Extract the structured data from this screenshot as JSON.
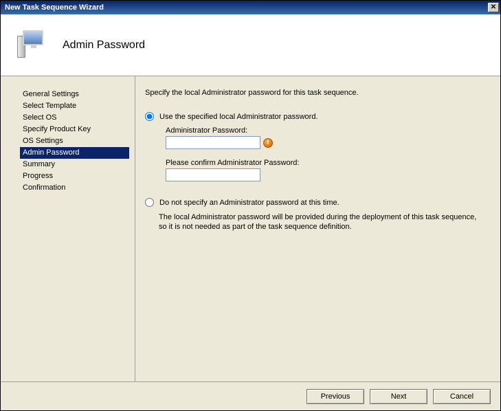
{
  "window": {
    "title": "New Task Sequence Wizard"
  },
  "header": {
    "title": "Admin Password"
  },
  "sidebar": {
    "items": [
      {
        "label": "General Settings",
        "selected": false
      },
      {
        "label": "Select Template",
        "selected": false
      },
      {
        "label": "Select OS",
        "selected": false
      },
      {
        "label": "Specify Product Key",
        "selected": false
      },
      {
        "label": "OS Settings",
        "selected": false
      },
      {
        "label": "Admin Password",
        "selected": true
      },
      {
        "label": "Summary",
        "selected": false
      },
      {
        "label": "Progress",
        "selected": false
      },
      {
        "label": "Confirmation",
        "selected": false
      }
    ]
  },
  "main": {
    "instruction": "Specify the local Administrator password for this task sequence.",
    "option1": {
      "label": "Use the specified local Administrator password.",
      "checked": true,
      "pw_label": "Administrator Password:",
      "pw_value": "",
      "confirm_label": "Please confirm Administrator Password:",
      "confirm_value": ""
    },
    "option2": {
      "label": "Do not specify an Administrator password at this time.",
      "checked": false,
      "description": "The local Administrator password will be provided during the deployment of this task sequence, so it is not needed as part of the task sequence definition."
    }
  },
  "footer": {
    "previous": "Previous",
    "next": "Next",
    "cancel": "Cancel"
  }
}
